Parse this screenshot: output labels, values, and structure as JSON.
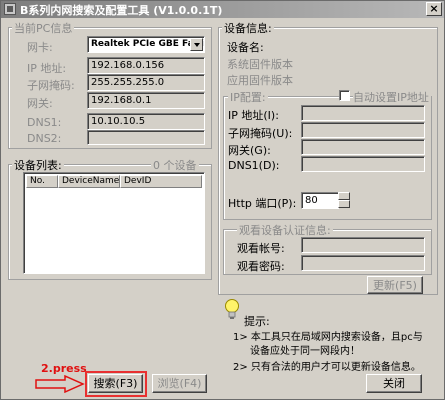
{
  "window": {
    "title": "B系列内网搜索及配置工具 (V1.0.0.1T)",
    "close_label": "×"
  },
  "pc_info": {
    "legend": "当前PC信息",
    "nic_label": "网卡:",
    "nic_value": "Realtek PCIe GBE Fami",
    "ip_label": "IP 地址:",
    "ip_value": "192.168.0.156",
    "mask_label": "子网掩码:",
    "mask_value": "255.255.255.0",
    "gw_label": "网关:",
    "gw_value": "192.168.0.1",
    "dns1_label": "DNS1:",
    "dns1_value": "10.10.10.5",
    "dns2_label": "DNS2:",
    "dns2_value": ""
  },
  "device_list": {
    "legend": "设备列表:",
    "count_text": "0 个设备",
    "columns": [
      "No.",
      "DeviceName",
      "DevID"
    ]
  },
  "device_info": {
    "legend": "设备信息:",
    "name_label": "设备名:",
    "sys_fw_label": "系统固件版本",
    "app_fw_label": "应用固件版本",
    "ip_config": {
      "legend": "IP配置:",
      "auto_label": "自动设置IP地址",
      "ip_label": "IP 地址(I):",
      "mask_label": "子网掩码(U):",
      "gw_label": "网关(G):",
      "dns1_label": "DNS1(D):",
      "http_port_label": "Http 端口(P):",
      "http_port_value": "80"
    },
    "auth": {
      "legend": "观看设备认证信息:",
      "account_label": "观看帐号:",
      "password_label": "观看密码:"
    },
    "update_button": "更新(F5)"
  },
  "hint": {
    "title": "提示:",
    "line1": "1> 本工具只在局域网内搜索设备，且pc与",
    "line2": "设备应处于同一网段内！",
    "line3": "2> 只有合法的用户才可以更新设备信息。"
  },
  "buttons": {
    "search": "搜索(F3)",
    "browse": "浏览(F4)",
    "close": "关闭"
  },
  "annotation": {
    "step_text": "2.press",
    "color": "#e01010"
  }
}
